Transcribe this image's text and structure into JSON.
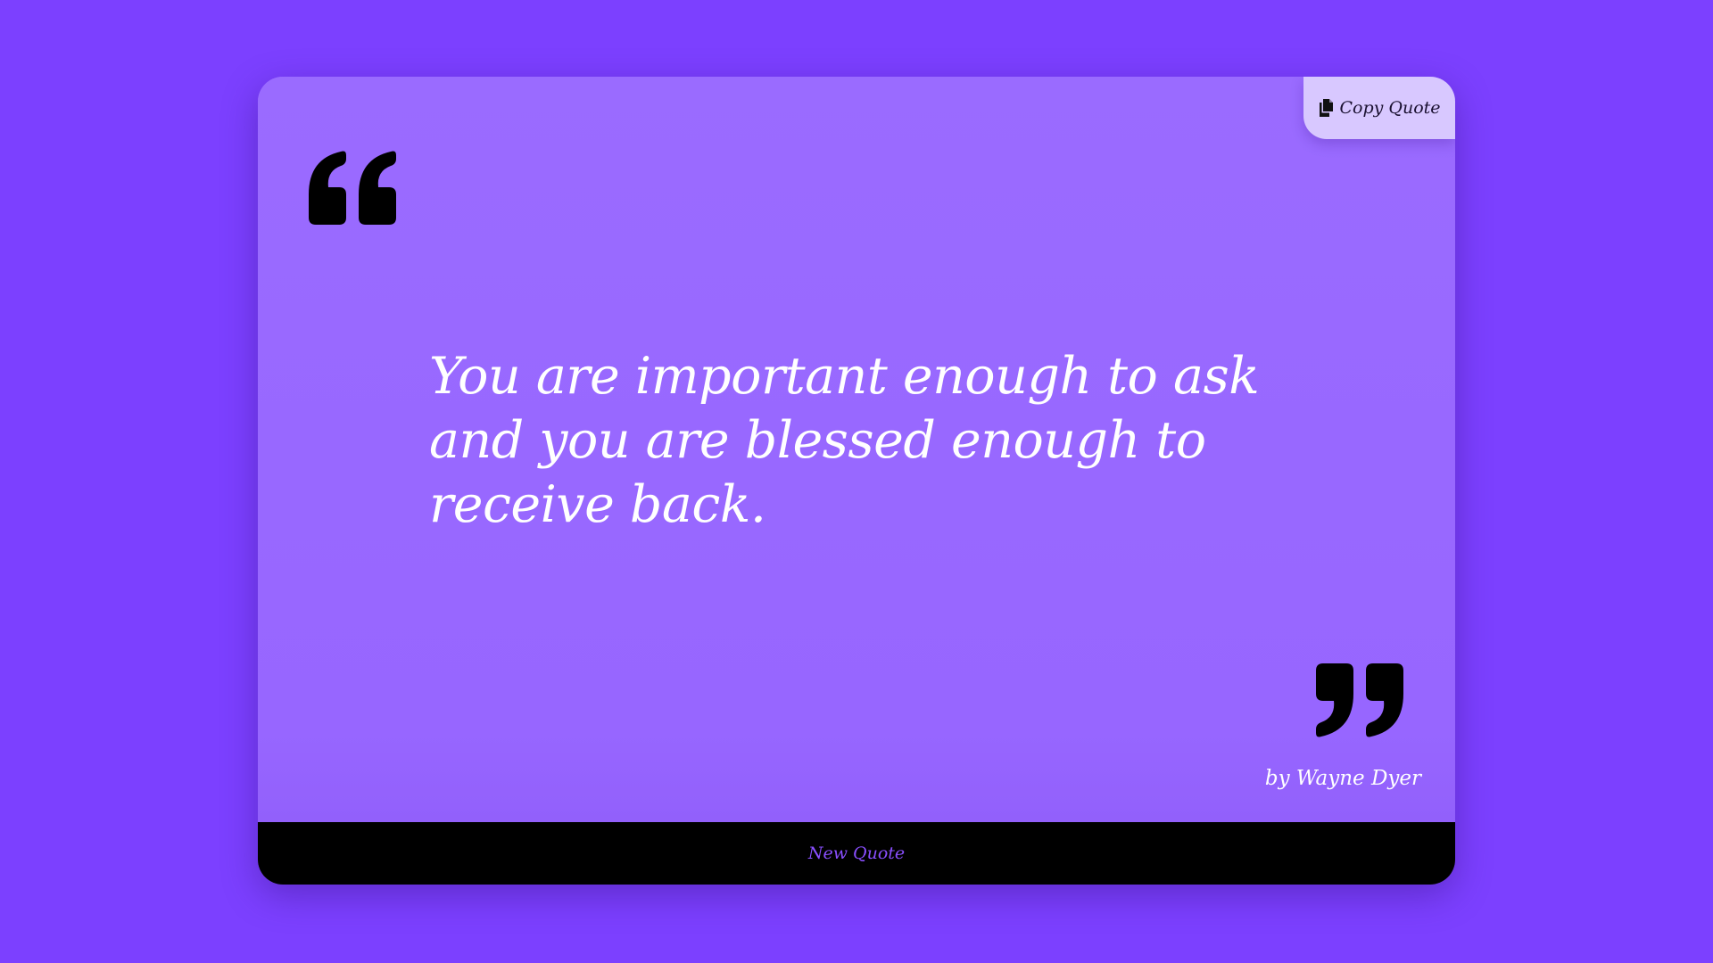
{
  "actions": {
    "copy_label": "Copy Quote",
    "copy_icon": "copy-icon",
    "new_quote_label": "New Quote"
  },
  "quote": {
    "text": "You are important enough to ask and you are blessed enough to receive back.",
    "author": "by Wayne Dyer",
    "open_mark_icon": "quote-left-icon",
    "close_mark_icon": "quote-right-icon"
  },
  "colors": {
    "background": "#7c40ff",
    "card": "#9868ff",
    "copy_button": "#d8c8ff",
    "footer": "#000000",
    "accent_text": "#8a4fff",
    "quote_text": "#ffffff"
  }
}
